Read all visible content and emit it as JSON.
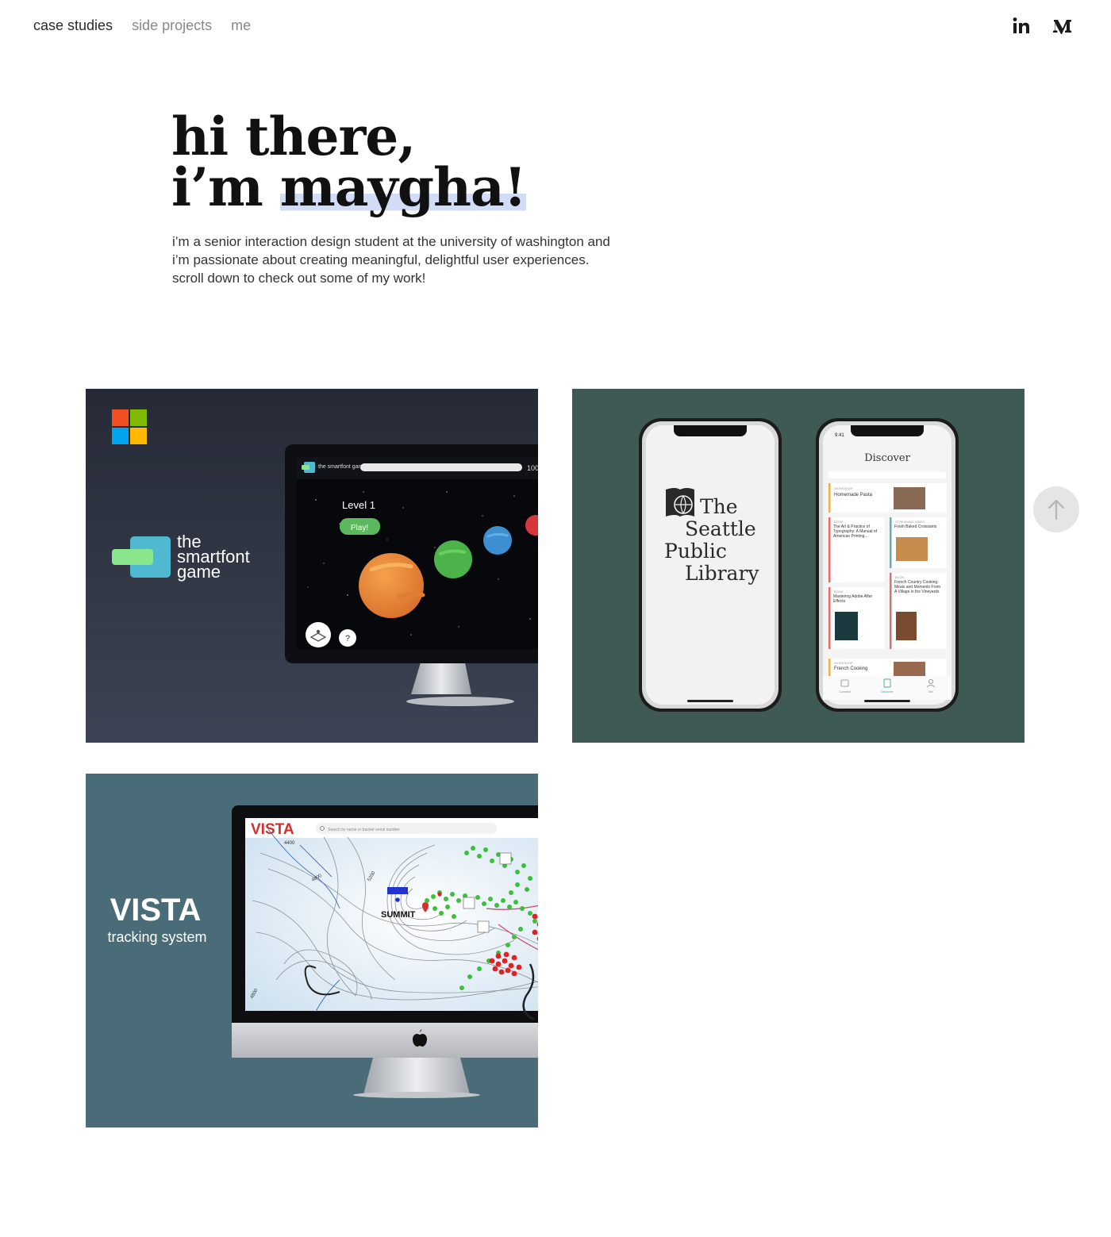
{
  "nav": {
    "items": [
      {
        "label": "case studies",
        "active": true
      },
      {
        "label": "side projects",
        "active": false
      },
      {
        "label": "me",
        "active": false
      }
    ]
  },
  "social": [
    {
      "name": "linkedin-icon"
    },
    {
      "name": "medium-icon"
    }
  ],
  "hero": {
    "line1": "hi there,",
    "line2_prefix": "i’m ",
    "line2_name": "maygha!",
    "highlight_color": "#d2dcf7",
    "intro": [
      "i’m a senior interaction design student at the university of washington and",
      "i’m passionate about creating meaningful, delightful user experiences.",
      "scroll down to check out some of my work!"
    ]
  },
  "projects": {
    "smartfont": {
      "bg_color": "#2c3140",
      "brand_line1": "the",
      "brand_line2": "smartfont",
      "brand_line3": "game",
      "screen_logo": "the smartfont game",
      "progress_text": "100",
      "level_text": "Level 1",
      "play_label": "Play!",
      "help_label": "?"
    },
    "library": {
      "bg_color": "#3f5a55",
      "logo_lines": [
        "The",
        "Seattle",
        "Public",
        "Library"
      ],
      "status_time": "9:41",
      "discover_title": "Discover",
      "cards": [
        {
          "tag": "WORKSHOP",
          "title": "Homemade Pasta",
          "color": "#e8b14a"
        },
        {
          "tag": "BOOK",
          "title": "The Art & Practice of Typography: A Manual of American Printing...",
          "color": "#e06c6c"
        },
        {
          "tag": "STREAMING VIDEO",
          "title": "Fresh Baked Croissants",
          "color": "#5bb5a8"
        },
        {
          "tag": "BOOK",
          "title": "Mastering Adobe After Effects",
          "color": "#e06c6c"
        },
        {
          "tag": "BOOK",
          "title": "French Country Cooking: Meals and Moments From A Village in the Vineyards",
          "color": "#e06c6c"
        },
        {
          "tag": "WORKSHOP",
          "title": "French Cooking",
          "color": "#e8b14a"
        }
      ],
      "tabs": [
        "Connect",
        "Discover",
        "Me"
      ]
    },
    "vista": {
      "bg_color": "#4a6b78",
      "brand": "VISTA",
      "tagline": "tracking system",
      "screen_logo": "VISTA",
      "search_placeholder": "Search by name or tracker serial number",
      "summit_label": "SUMMIT",
      "elevations": [
        "4400",
        "4800",
        "5200",
        "4800"
      ],
      "accent_color": "#d62d2d"
    }
  }
}
